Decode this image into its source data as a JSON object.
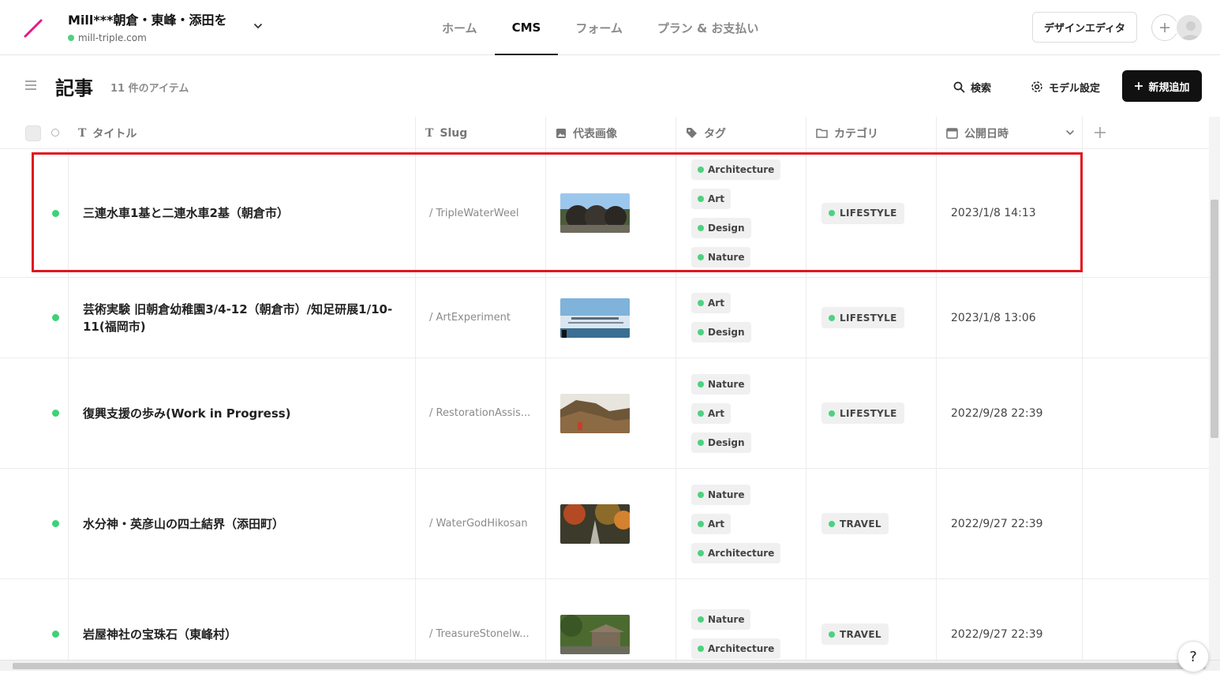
{
  "site": {
    "name": "Mill***朝倉・東峰・添田を",
    "domain": "mill-triple.com"
  },
  "nav": {
    "tabs": [
      {
        "label": "ホーム"
      },
      {
        "label": "CMS"
      },
      {
        "label": "フォーム"
      },
      {
        "label": "プラン & お支払い"
      }
    ],
    "active": "CMS"
  },
  "header": {
    "design_editor": "デザインエディタ"
  },
  "collection": {
    "title": "記事",
    "count": "11 件のアイテム",
    "search": "検索",
    "model_settings": "モデル設定",
    "new_item": "新規追加"
  },
  "columns": {
    "title": "タイトル",
    "slug": "Slug",
    "image": "代表画像",
    "tags": "タグ",
    "category": "カテゴリ",
    "date": "公開日時"
  },
  "rows": [
    {
      "title": "三連水車1基と二連水車2基（朝倉市）",
      "slug": "/ TripleWaterWeel",
      "tags": [
        "Architecture",
        "Art",
        "Design",
        "Nature"
      ],
      "category": "LIFESTYLE",
      "date": "2023/1/8 14:13",
      "thumb": "water-wheel"
    },
    {
      "title": "芸術実験 旧朝倉幼稚園3/4-12（朝倉市）/知足研展1/10-11(福岡市)",
      "slug": "/ ArtExperiment",
      "tags": [
        "Art",
        "Design"
      ],
      "category": "LIFESTYLE",
      "date": "2023/1/8 13:06",
      "thumb": "art-poster"
    },
    {
      "title": "復興支援の歩み(Work in Progress)",
      "slug": "/ RestorationAssis...",
      "tags": [
        "Nature",
        "Art",
        "Design"
      ],
      "category": "LIFESTYLE",
      "date": "2022/9/28 22:39",
      "thumb": "debris"
    },
    {
      "title": "水分神・英彦山の四土結界（添田町）",
      "slug": "/ WaterGodHikosan",
      "tags": [
        "Nature",
        "Art",
        "Architecture"
      ],
      "category": "TRAVEL",
      "date": "2022/9/27 22:39",
      "thumb": "autumn-path"
    },
    {
      "title": "岩屋神社の宝珠石（東峰村）",
      "slug": "/ TreasureStonelw...",
      "tags": [
        "Nature",
        "Architecture"
      ],
      "category": "TRAVEL",
      "date": "2022/9/27 22:39",
      "thumb": "shrine"
    }
  ],
  "help": "?",
  "colors": {
    "accent": "#e6178a",
    "status": "#3dd277",
    "highlight": "#e0161e"
  }
}
